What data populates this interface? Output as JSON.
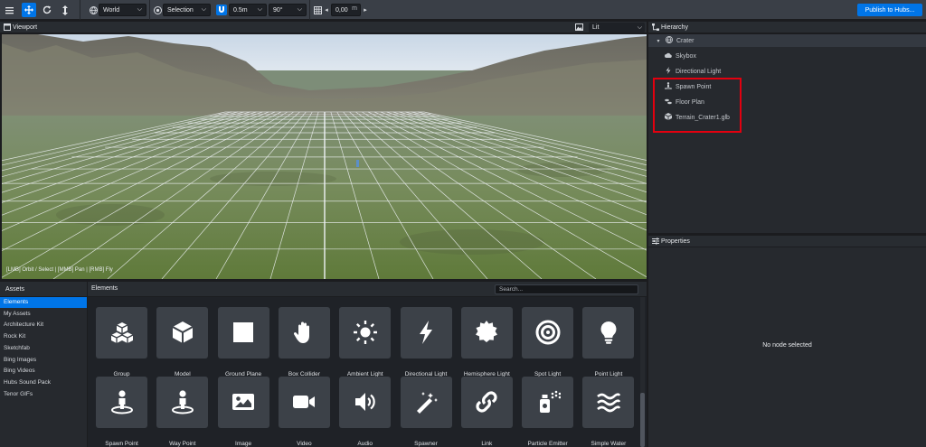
{
  "toolbar": {
    "transform_space": "World",
    "pivot": "Selection",
    "translation_snap": "0.5m",
    "rotation_snap": "90°",
    "grid_height": "0,00",
    "grid_unit": "m",
    "publish_label": "Publish to Hubs..."
  },
  "viewport": {
    "title": "Viewport",
    "render_mode": "Lit",
    "controls_hint": "[LMB] Orbit / Select | [MMB] Pan | [RMB] Fly"
  },
  "hierarchy": {
    "title": "Hierarchy",
    "root": "Crater",
    "items": [
      {
        "label": "Skybox",
        "icon": "cloud-icon"
      },
      {
        "label": "Directional Light",
        "icon": "bolt-icon"
      },
      {
        "label": "Spawn Point",
        "icon": "street-view-icon"
      },
      {
        "label": "Floor Plan",
        "icon": "shoe-prints-icon"
      },
      {
        "label": "Terrain_Crater1.glb",
        "icon": "cube-icon"
      }
    ]
  },
  "properties": {
    "title": "Properties",
    "empty_text": "No node selected"
  },
  "assets": {
    "title": "Assets",
    "items": [
      "Elements",
      "My Assets",
      "Architecture Kit",
      "Rock Kit",
      "Sketchfab",
      "Bing Images",
      "Bing Videos",
      "Hubs Sound Pack",
      "Tenor GIFs"
    ],
    "selected": "Elements"
  },
  "elements": {
    "title": "Elements",
    "search_placeholder": "Search...",
    "items": [
      {
        "label": "Group",
        "icon": "cubes-icon"
      },
      {
        "label": "Model",
        "icon": "cube-icon"
      },
      {
        "label": "Ground Plane",
        "icon": "square-icon"
      },
      {
        "label": "Box Collider",
        "icon": "hand-paper-icon"
      },
      {
        "label": "Ambient Light",
        "icon": "sun-icon"
      },
      {
        "label": "Directional Light",
        "icon": "bolt-icon"
      },
      {
        "label": "Hemisphere Light",
        "icon": "certificate-icon"
      },
      {
        "label": "Spot Light",
        "icon": "bullseye-icon"
      },
      {
        "label": "Point Light",
        "icon": "lightbulb-icon"
      },
      {
        "label": "Spawn Point",
        "icon": "street-view-icon"
      },
      {
        "label": "Way Point",
        "icon": "street-view-icon"
      },
      {
        "label": "Image",
        "icon": "image-icon"
      },
      {
        "label": "Video",
        "icon": "video-icon"
      },
      {
        "label": "Audio",
        "icon": "volume-up-icon"
      },
      {
        "label": "Spawner",
        "icon": "magic-icon"
      },
      {
        "label": "Link",
        "icon": "link-icon"
      },
      {
        "label": "Particle Emitter",
        "icon": "spray-can-icon"
      },
      {
        "label": "Simple Water",
        "icon": "water-icon"
      }
    ]
  },
  "colors": {
    "accent": "#0075e8",
    "highlight_box": "#e3000f",
    "panel_bg": "#26292e",
    "toolbar_bg": "#3a3f47"
  }
}
